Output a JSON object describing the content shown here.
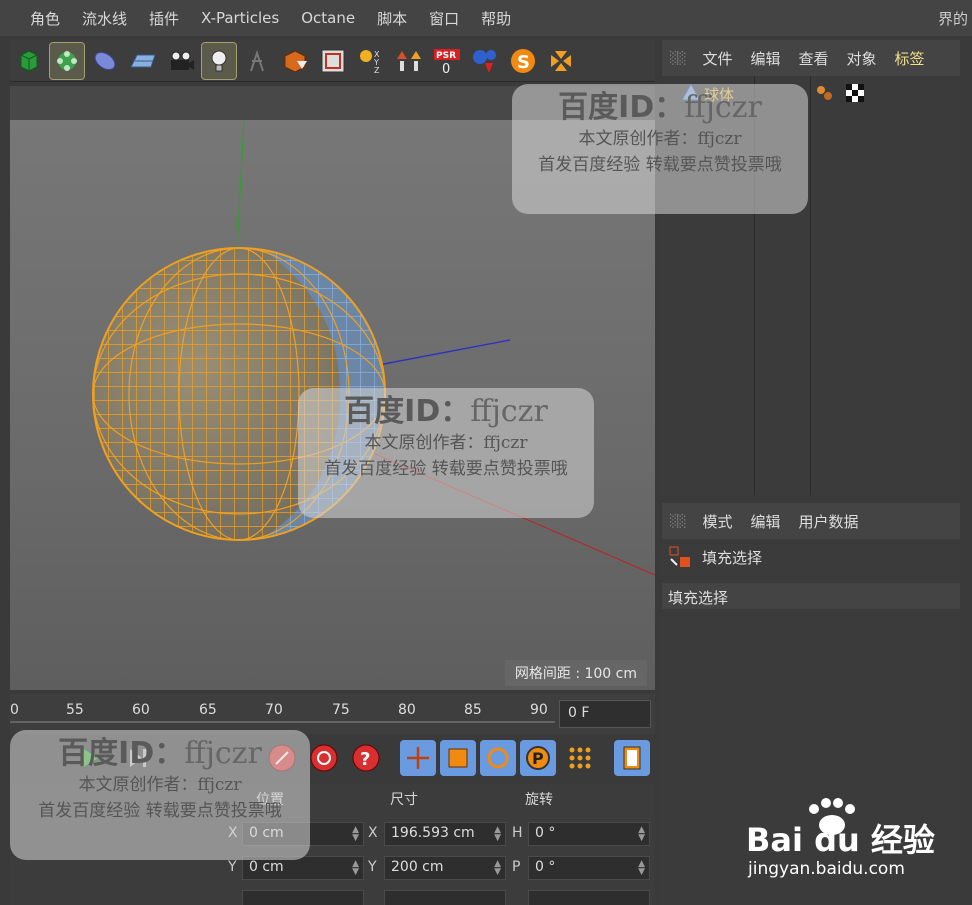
{
  "menubar": {
    "items": [
      "角色",
      "流水线",
      "插件",
      "X-Particles",
      "Octane",
      "脚本",
      "窗口",
      "帮助"
    ],
    "right_cut": "界的"
  },
  "object_panel": {
    "tabs": [
      "文件",
      "编辑",
      "查看",
      "对象",
      "标签"
    ],
    "object_name": "球体"
  },
  "attribute_panel": {
    "tabs": [
      "模式",
      "编辑",
      "用户数据"
    ],
    "item_label": "填充选择",
    "section_title": "填充选择"
  },
  "viewport": {
    "grid_label": "网格间距 : 100 cm"
  },
  "timeline": {
    "ticks": [
      "0",
      "55",
      "60",
      "65",
      "70",
      "75",
      "80",
      "85",
      "90"
    ],
    "frame_value": "0 F"
  },
  "coordinates": {
    "headers": [
      "位置",
      "尺寸",
      "旋转"
    ],
    "rows": [
      {
        "pos_axis": "X",
        "pos_value": "0 cm",
        "size_axis": "X",
        "size_value": "196.593 cm",
        "rot_axis": "H",
        "rot_value": "0 °"
      },
      {
        "pos_axis": "Y",
        "pos_value": "0 cm",
        "size_axis": "Y",
        "size_value": "200 cm",
        "rot_axis": "P",
        "rot_value": "0 °"
      }
    ]
  },
  "watermarks": {
    "id_prefix": "百度ID：",
    "id_name": "ffjczr",
    "line1": "本文原创作者：ffjczr",
    "line2": "首发百度经验 转载要点赞投票哦"
  },
  "baidu": {
    "logo": "Bai du 经验",
    "url": "jingyan.baidu.com"
  },
  "colors": {
    "accent_orange": "#f0a020",
    "selection_blue": "#6e9fd8",
    "panel_bg": "#3b3b3b"
  }
}
